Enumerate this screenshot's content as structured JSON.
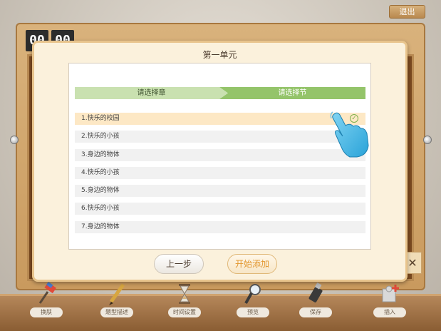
{
  "top": {
    "exit_label": "退出",
    "timer_digits": [
      "00",
      "00"
    ]
  },
  "dialog": {
    "title": "第一单元",
    "steps": [
      "请选择章",
      "请选择节"
    ],
    "items": [
      {
        "label": "1.快乐的校园",
        "selected": true
      },
      {
        "label": "2.快乐的小孩",
        "selected": false
      },
      {
        "label": "3.身边的物体",
        "selected": false
      },
      {
        "label": "4.快乐的小孩",
        "selected": false
      },
      {
        "label": "5.身边的物体",
        "selected": false
      },
      {
        "label": "6.快乐的小孩",
        "selected": false
      },
      {
        "label": "7.身边的物体",
        "selected": false
      }
    ],
    "buttons": {
      "prev": "上一步",
      "start": "开始添加"
    }
  },
  "side_close_icon": "close-icon",
  "toolbar": [
    {
      "label": "换肤",
      "icon": "paint-roller-icon"
    },
    {
      "label": "题型描述",
      "icon": "pencil-icon"
    },
    {
      "label": "时间设置",
      "icon": "hourglass-icon"
    },
    {
      "label": "预览",
      "icon": "magnifier-icon"
    },
    {
      "label": "保存",
      "icon": "usb-drive-icon"
    },
    {
      "label": "插入",
      "icon": "puzzle-plus-icon"
    }
  ],
  "colors": {
    "dialog_bg": "#fbf1dc",
    "step_active": "#94c46a",
    "step_inactive": "#c9e1b0",
    "selected_row": "#fde8c5",
    "accent_orange": "#e2962d"
  }
}
